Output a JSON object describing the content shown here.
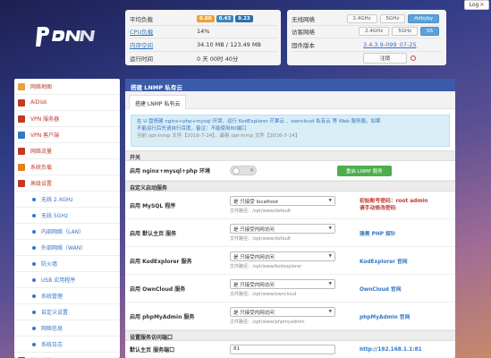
{
  "logo": {
    "text": "pdn"
  },
  "logout": {
    "label": "Log",
    "icon": "close-icon"
  },
  "stats": {
    "load_label": "平均负载",
    "load_badges": [
      "0.60",
      "0.43",
      "0.23"
    ],
    "cpu_label": "CPU负载",
    "cpu_value": "14%",
    "mem_label": "内存空间",
    "mem_value": "34.10 MB / 123.49 MB",
    "uptime_label": "运行时间",
    "uptime_value": "0 天 00时 40分"
  },
  "network": {
    "wifi_label": "无线网络",
    "wifi_options": [
      "2.4GHz",
      "5GHz",
      "Adbyby"
    ],
    "guest_label": "访客网络",
    "guest_options": [
      "2.4GHz",
      "5GHz",
      "SS"
    ],
    "firmware_label": "固件版本",
    "firmware_value": "3.4.3.9-099_07-25",
    "logout_label": "注销"
  },
  "sidebar": {
    "items": [
      {
        "label": "网络地图",
        "type": "top"
      },
      {
        "label": "AiDisk",
        "type": "top"
      },
      {
        "label": "VPN 服务器",
        "type": "top"
      },
      {
        "label": "VPN 客户端",
        "type": "top"
      },
      {
        "label": "网络流量",
        "type": "top"
      },
      {
        "label": "系统负载",
        "type": "top"
      },
      {
        "label": "高级设置",
        "type": "top"
      },
      {
        "label": "无线 2.4GHz",
        "type": "sub"
      },
      {
        "label": "无线 5GHz",
        "type": "sub"
      },
      {
        "label": "内部网络（LAN）",
        "type": "sub"
      },
      {
        "label": "外部网络（WAN）",
        "type": "sub"
      },
      {
        "label": "防火墙",
        "type": "sub"
      },
      {
        "label": "USB 应用程序",
        "type": "sub"
      },
      {
        "label": "系统管理",
        "type": "sub"
      },
      {
        "label": "自定义设置",
        "type": "sub"
      },
      {
        "label": "网络信息",
        "type": "sub"
      },
      {
        "label": "系统日志",
        "type": "sub"
      },
      {
        "label": "扩展功能",
        "type": "dark"
      }
    ]
  },
  "main": {
    "title": "搭建 LNMP 私有云",
    "tab_label": "搭建 LNMP 私有云",
    "info_line1": "在 U 盘搭建 nginx+php+mysql 环境，运行 KodExplorer 芒果云 、owncloud 私有云 等 Web 服务器。如果",
    "info_line2": "不能运行后先请自行百度，备注：不能使用80端口",
    "info_line3": "当前 opt-lnmp 文件【2016-7-24】，最新 opt-lnmp 文件【2016-7-24】",
    "switch_section": "开关",
    "enable_label": "启用 nginx+mysql+php 环境",
    "start_button": "重启 LNMP 服务",
    "custom_section": "自定义启动服务",
    "rows": [
      {
        "label": "启用 MySQL 程序",
        "select": "是 只接受 localhost",
        "path": "文件路径：/opt/www/default",
        "note1": "初始账号密码：root admin",
        "note2": "请手动修改密码",
        "note_type": "red"
      },
      {
        "label": "启用 默认主页 服务",
        "select": "是 只接受内网访问",
        "path": "文件路径：/opt/www/default",
        "note1": "雅黑 PHP 探针",
        "note2": "",
        "note_type": "link"
      },
      {
        "label": "启用 KodExplorer 服务",
        "select": "是 只接受内网访问",
        "path": "文件路径：/opt/www/kodexplorer",
        "note1": "KodExplorer 官网",
        "note2": "",
        "note_type": "link"
      },
      {
        "label": "启用 OwnCloud 服务",
        "select": "是 只接受内网访问",
        "path": "文件路径：/opt/www/owncloud",
        "note1": "OwnCloud 官网",
        "note2": "",
        "note_type": "link"
      },
      {
        "label": "启用 phpMyAdmin 服务",
        "select": "是 只接受内网访问",
        "path": "文件路径：/opt/www/phpmyadmin",
        "note1": "phpMyAdmin 官网",
        "note2": "",
        "note_type": "link"
      }
    ],
    "port_section": "设置服务访问端口",
    "port_label": "默认主页 服务端口",
    "port_value": "81",
    "port_link": "http://192.168.1.1:81"
  },
  "colors": {
    "header_blue": "#3b5ba8",
    "link": "#3477c2",
    "accent_red": "#c0392b"
  }
}
